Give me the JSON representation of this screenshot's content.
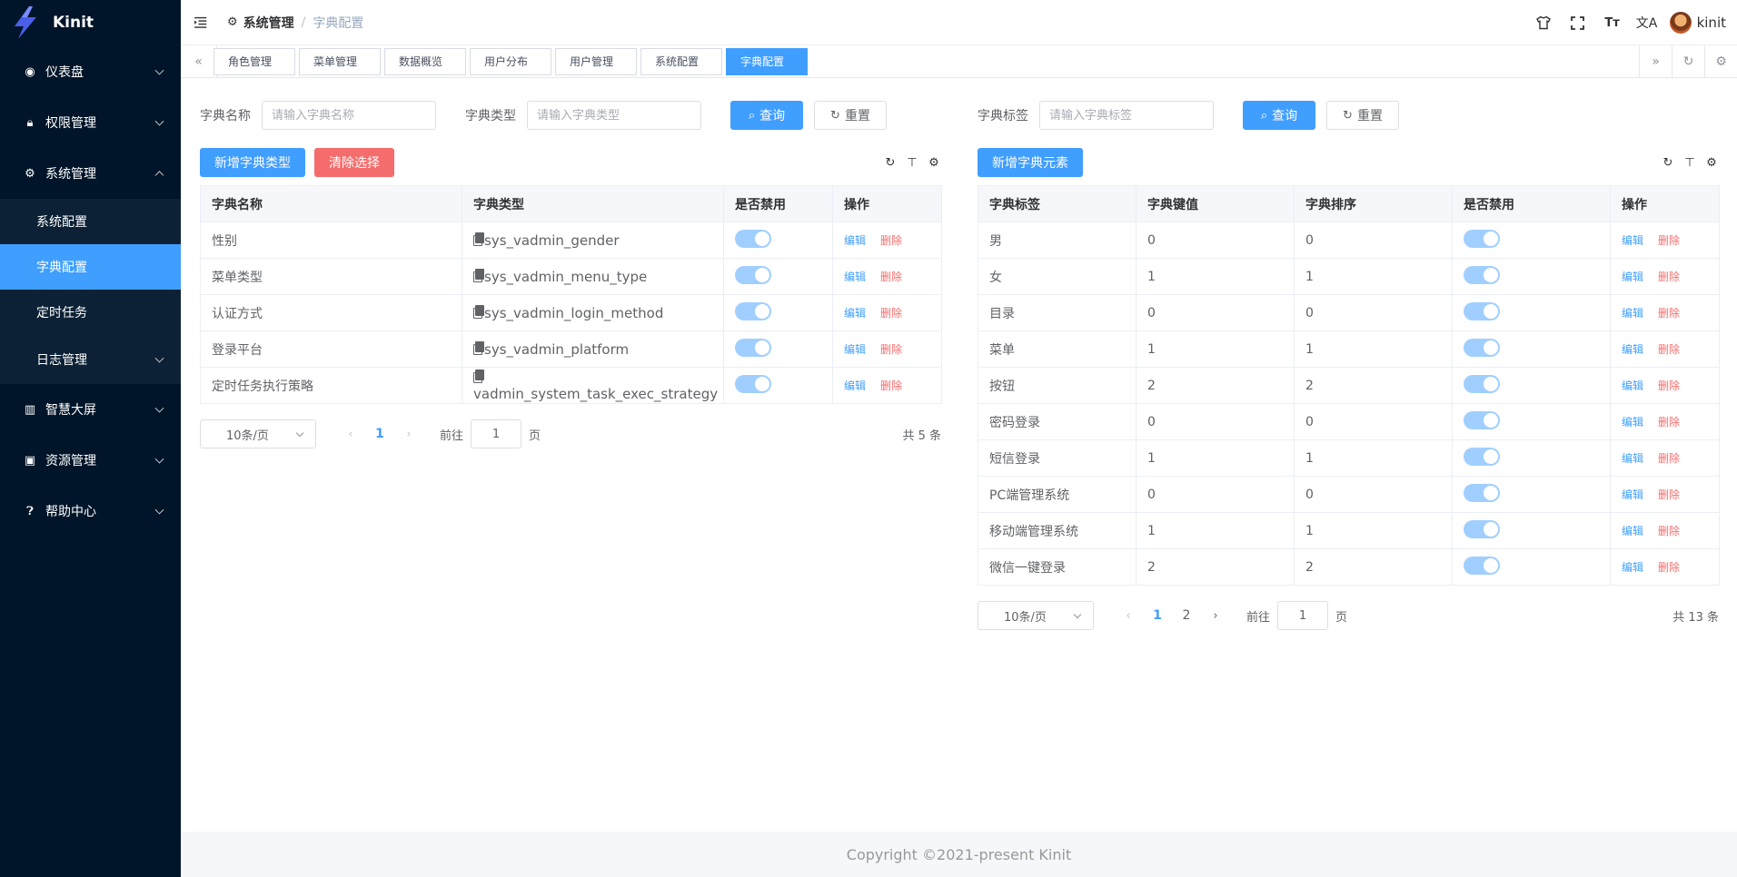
{
  "app": {
    "name": "Kinit"
  },
  "sidebar": {
    "items": [
      {
        "label": "仪表盘",
        "icon": "dashboard-icon"
      },
      {
        "label": "权限管理",
        "icon": "lock-icon"
      },
      {
        "label": "系统管理",
        "icon": "gear-icon",
        "expanded": true,
        "children": [
          {
            "label": "系统配置"
          },
          {
            "label": "字典配置",
            "active": true
          },
          {
            "label": "定时任务"
          },
          {
            "label": "日志管理",
            "has_children": true
          }
        ]
      },
      {
        "label": "智慧大屏",
        "icon": "chart-icon"
      },
      {
        "label": "资源管理",
        "icon": "image-icon"
      },
      {
        "label": "帮助中心",
        "icon": "help-icon"
      }
    ]
  },
  "header": {
    "breadcrumb": {
      "parent": "系统管理",
      "current": "字典配置",
      "separator": "/"
    },
    "user_name": "kinit"
  },
  "tags": [
    "角色管理",
    "菜单管理",
    "数据概览",
    "用户分布",
    "用户管理",
    "系统配置",
    "字典配置"
  ],
  "left_panel": {
    "search": {
      "name_label": "字典名称",
      "name_placeholder": "请输入字典名称",
      "type_label": "字典类型",
      "type_placeholder": "请输入字典类型",
      "query_label": "查询",
      "reset_label": "重置"
    },
    "toolbar": {
      "add_label": "新增字典类型",
      "clear_label": "清除选择"
    },
    "columns": [
      "字典名称",
      "字典类型",
      "是否禁用",
      "操作"
    ],
    "rows": [
      {
        "name": "性别",
        "type": "sys_vadmin_gender"
      },
      {
        "name": "菜单类型",
        "type": "sys_vadmin_menu_type"
      },
      {
        "name": "认证方式",
        "type": "sys_vadmin_login_method"
      },
      {
        "name": "登录平台",
        "type": "sys_vadmin_platform"
      },
      {
        "name": "定时任务执行策略",
        "type": "vadmin_system_task_exec_strategy"
      }
    ],
    "actions": {
      "edit": "编辑",
      "delete": "删除"
    },
    "pager": {
      "size": "10条/页",
      "pages": [
        "1"
      ],
      "current": "1",
      "goto": "前往",
      "page_value": "1",
      "page_unit": "页",
      "total": "共 5 条"
    }
  },
  "right_panel": {
    "search": {
      "label_label": "字典标签",
      "label_placeholder": "请输入字典标签",
      "query_label": "查询",
      "reset_label": "重置"
    },
    "toolbar": {
      "add_label": "新增字典元素"
    },
    "columns": [
      "字典标签",
      "字典键值",
      "字典排序",
      "是否禁用",
      "操作"
    ],
    "rows": [
      {
        "label": "男",
        "value": "0",
        "order": "0"
      },
      {
        "label": "女",
        "value": "1",
        "order": "1"
      },
      {
        "label": "目录",
        "value": "0",
        "order": "0"
      },
      {
        "label": "菜单",
        "value": "1",
        "order": "1"
      },
      {
        "label": "按钮",
        "value": "2",
        "order": "2"
      },
      {
        "label": "密码登录",
        "value": "0",
        "order": "0"
      },
      {
        "label": "短信登录",
        "value": "1",
        "order": "1"
      },
      {
        "label": "PC端管理系统",
        "value": "0",
        "order": "0"
      },
      {
        "label": "移动端管理系统",
        "value": "1",
        "order": "1"
      },
      {
        "label": "微信一键登录",
        "value": "2",
        "order": "2"
      }
    ],
    "actions": {
      "edit": "编辑",
      "delete": "删除"
    },
    "pager": {
      "size": "10条/页",
      "pages": [
        "1",
        "2"
      ],
      "current": "1",
      "goto": "前往",
      "page_value": "1",
      "page_unit": "页",
      "total": "共 13 条"
    }
  },
  "footer": {
    "copyright": "Copyright ©2021-present Kinit"
  },
  "colors": {
    "primary": "#409eff",
    "danger": "#f56c6c",
    "sidebar_bg": "#001529",
    "switch_on": "#a0cfff"
  }
}
